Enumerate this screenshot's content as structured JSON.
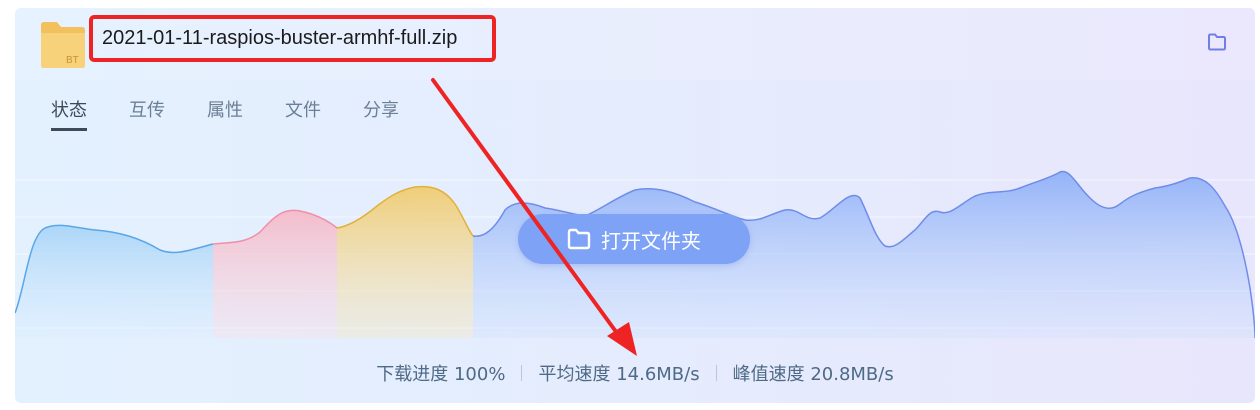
{
  "download": {
    "filename": "2021-01-11-raspios-buster-armhf-full.zip",
    "file_icon": "bt-folder-icon",
    "file_icon_badge": "BT"
  },
  "tabs": [
    {
      "label": "状态",
      "active": true
    },
    {
      "label": "互传",
      "active": false
    },
    {
      "label": "属性",
      "active": false
    },
    {
      "label": "文件",
      "active": false
    },
    {
      "label": "分享",
      "active": false
    }
  ],
  "open_folder_label": "打开文件夹",
  "stats": {
    "progress_label": "下载进度",
    "progress_value": "100%",
    "avg_label": "平均速度",
    "avg_value": "14.6MB/s",
    "peak_label": "峰值速度",
    "peak_value": "20.8MB/s"
  },
  "colors": {
    "accent": "#7ea2f5",
    "annotation_red": "#ee2424",
    "chart_pink": "#f3a5b8",
    "chart_yellow": "#f0c25a",
    "chart_blue": "#7d9df0"
  }
}
